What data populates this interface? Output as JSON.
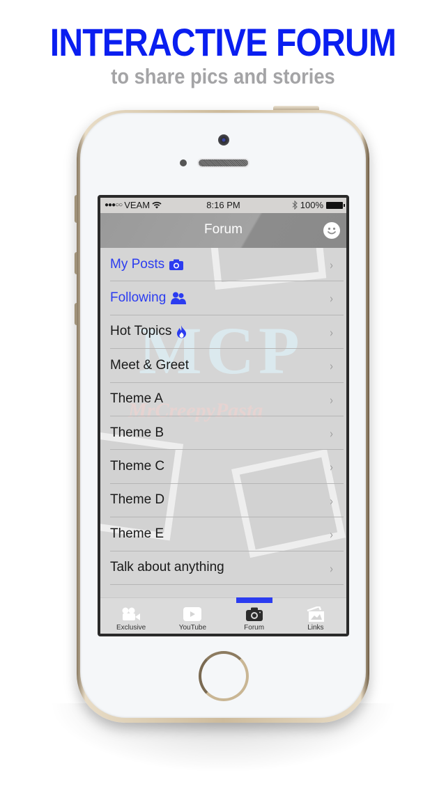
{
  "promo": {
    "headline": "INTERACTIVE FORUM",
    "subheadline": "to share pics and stories",
    "headline_color": "#0a1ef0",
    "subheadline_color": "#a4a4a6"
  },
  "status_bar": {
    "signal": "●●●○○",
    "carrier": "VEAM",
    "time": "8:16 PM",
    "battery": "100%"
  },
  "nav_bar": {
    "title": "Forum",
    "right_icon": "smiley-icon"
  },
  "forum_list": {
    "items": [
      {
        "label": "My Posts",
        "icon": "camera-icon",
        "highlighted": true
      },
      {
        "label": "Following",
        "icon": "users-icon",
        "highlighted": true
      },
      {
        "label": "Hot Topics",
        "icon": "flame-icon",
        "highlighted": false
      },
      {
        "label": "Meet & Greet",
        "icon": null,
        "highlighted": false
      },
      {
        "label": "Theme A",
        "icon": null,
        "highlighted": false
      },
      {
        "label": "Theme B",
        "icon": null,
        "highlighted": false
      },
      {
        "label": "Theme C",
        "icon": null,
        "highlighted": false
      },
      {
        "label": "Theme D",
        "icon": null,
        "highlighted": false
      },
      {
        "label": "Theme E",
        "icon": null,
        "highlighted": false
      },
      {
        "label": "Talk about anything",
        "icon": null,
        "highlighted": false
      }
    ],
    "chevron": "›"
  },
  "background_art": {
    "logo_text": "MCP",
    "script_text": "MrCreepyPasta"
  },
  "tab_bar": {
    "active_index": 2,
    "accent_color": "#2b3cf0",
    "tabs": [
      {
        "label": "Exclusive",
        "icon": "video-camera-icon"
      },
      {
        "label": "YouTube",
        "icon": "youtube-play-icon"
      },
      {
        "label": "Forum",
        "icon": "camera-icon"
      },
      {
        "label": "Links",
        "icon": "photos-icon"
      }
    ]
  }
}
